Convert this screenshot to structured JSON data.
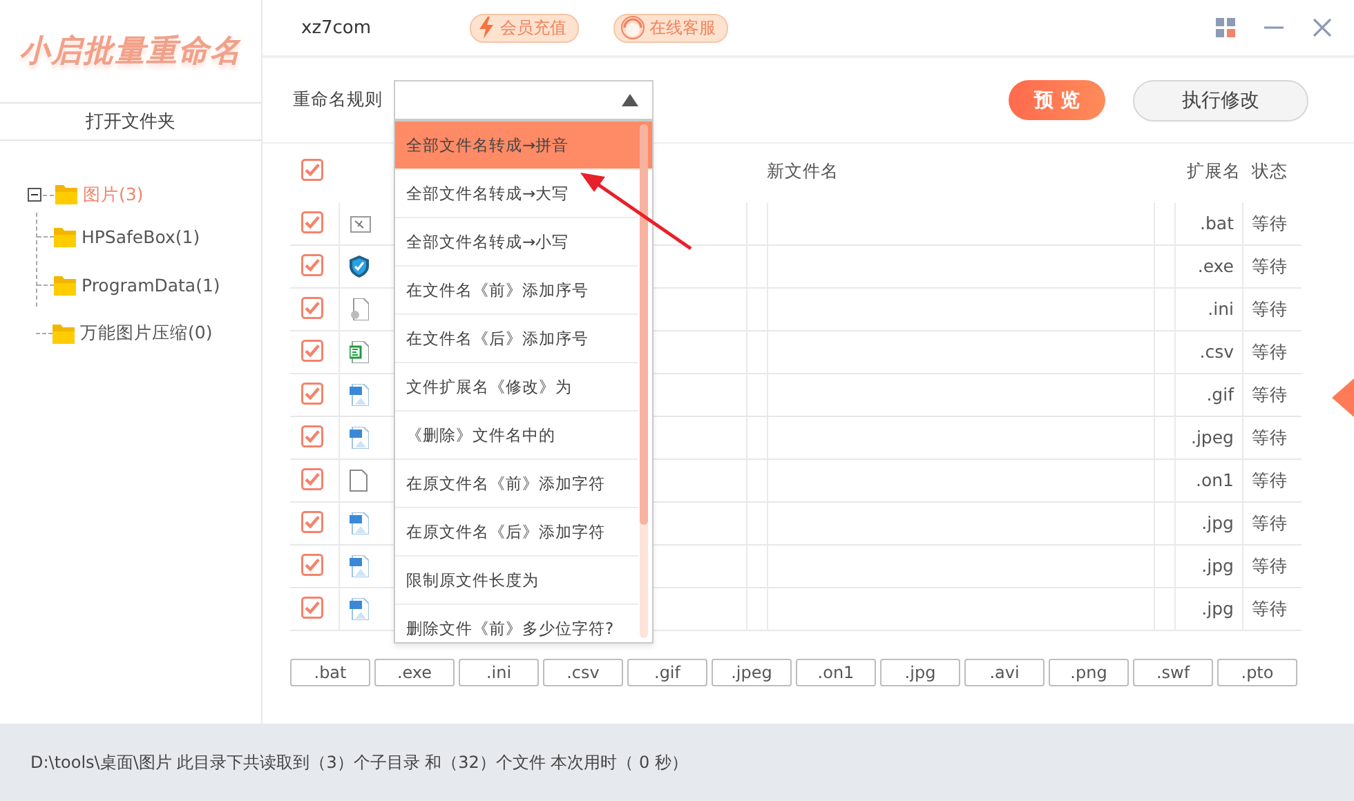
{
  "logo": "小启批量重命名",
  "open_folder_button": "打开文件夹",
  "tree": [
    {
      "label": "图片(3)",
      "expanded": true,
      "selected": true,
      "children": [
        {
          "label": "HPSafeBox(1)",
          "selected": false
        },
        {
          "label": "ProgramData(1)",
          "selected": false
        },
        {
          "label": "万能图片压缩(0)",
          "selected": false
        }
      ]
    }
  ],
  "header": {
    "site": "xz7com",
    "badges": [
      {
        "label": "会员充值",
        "kind": "bolt"
      },
      {
        "label": "在线客服",
        "kind": "agent"
      }
    ]
  },
  "rule": {
    "label": "重命名规则",
    "expanded": true,
    "options": [
      {
        "label": "全部文件名转成→拼音",
        "selected": true
      },
      {
        "label": "全部文件名转成→大写",
        "selected": false
      },
      {
        "label": "全部文件名转成→小写",
        "selected": false
      },
      {
        "label": "在文件名《前》添加序号",
        "selected": false
      },
      {
        "label": "在文件名《后》添加序号",
        "selected": false
      },
      {
        "label": "文件扩展名《修改》为",
        "selected": false
      },
      {
        "label": "《删除》文件名中的",
        "selected": false
      },
      {
        "label": "在原文件名《前》添加字符",
        "selected": false
      },
      {
        "label": "在原文件名《后》添加字符",
        "selected": false
      },
      {
        "label": "限制原文件长度为",
        "selected": false
      },
      {
        "label": "删除文件《前》多少位字符?",
        "selected": false
      }
    ]
  },
  "buttons": [
    {
      "label": "预 览",
      "kind": "primary"
    },
    {
      "label": "执行修改",
      "kind": "secondary"
    }
  ],
  "table": {
    "header_checked": true,
    "columns": [
      "新文件名",
      "扩展名",
      "状态"
    ],
    "rows": [
      {
        "checked": true,
        "kind": "script",
        "extension": ".bat",
        "status": "等待"
      },
      {
        "checked": true,
        "kind": "shield",
        "extension": ".exe",
        "status": "等待"
      },
      {
        "checked": true,
        "kind": "config",
        "extension": ".ini",
        "status": "等待"
      },
      {
        "checked": true,
        "kind": "sheet",
        "extension": ".csv",
        "status": "等待"
      },
      {
        "checked": true,
        "kind": "image",
        "extension": ".gif",
        "status": "等待"
      },
      {
        "checked": true,
        "kind": "image",
        "extension": ".jpeg",
        "status": "等待"
      },
      {
        "checked": true,
        "kind": "blank",
        "extension": ".on1",
        "status": "等待"
      },
      {
        "checked": true,
        "kind": "image",
        "extension": ".jpg",
        "status": "等待"
      },
      {
        "checked": true,
        "kind": "image",
        "extension": ".jpg",
        "status": "等待"
      },
      {
        "checked": true,
        "kind": "image",
        "extension": ".jpg",
        "status": "等待"
      }
    ]
  },
  "extension_filters": [
    ".bat",
    ".exe",
    ".ini",
    ".csv",
    ".gif",
    ".jpeg",
    ".on1",
    ".jpg",
    ".avi",
    ".png",
    ".swf",
    ".pto"
  ],
  "status_bar": "D:\\tools\\桌面\\图片 此目录下共读取到（3）个子目录 和（32）个文件 本次用时（ 0 秒）"
}
